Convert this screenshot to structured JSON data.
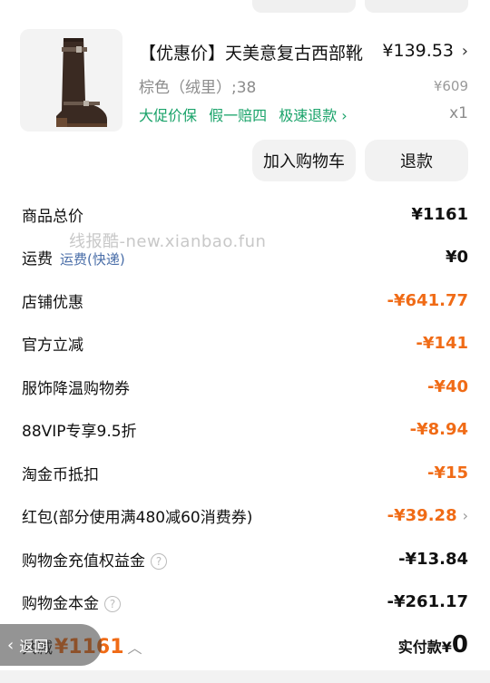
{
  "product": {
    "title": "【优惠价】天美意复古西部靴",
    "price": "¥139.53",
    "spec": "棕色（绒里）;38",
    "original_price": "¥609",
    "tags": [
      "大促价保",
      "假一赔四",
      "极速退款 ›"
    ],
    "quantity": "x1",
    "image_icon": "boot-image"
  },
  "actions": {
    "add_cart": "加入购物车",
    "refund": "退款"
  },
  "watermark": "线报酷-new.xianbao.fun",
  "rows": [
    {
      "label": "商品总价",
      "sub": "",
      "value": "¥1161",
      "orange": false,
      "help": false,
      "chevron": false
    },
    {
      "label": "运费",
      "sub": "运费(快递)",
      "value": "¥0",
      "orange": false,
      "help": false,
      "chevron": false
    },
    {
      "label": "店铺优惠",
      "sub": "",
      "value": "-¥641.77",
      "orange": true,
      "help": false,
      "chevron": false
    },
    {
      "label": "官方立减",
      "sub": "",
      "value": "-¥141",
      "orange": true,
      "help": false,
      "chevron": false
    },
    {
      "label": "服饰降温购物券",
      "sub": "",
      "value": "-¥40",
      "orange": true,
      "help": false,
      "chevron": false
    },
    {
      "label": "88VIP专享9.5折",
      "sub": "",
      "value": "-¥8.94",
      "orange": true,
      "help": false,
      "chevron": false
    },
    {
      "label": "淘金币抵扣",
      "sub": "",
      "value": "-¥15",
      "orange": true,
      "help": false,
      "chevron": false
    },
    {
      "label": "红包(部分使用满480减60消费券)",
      "sub": "",
      "value": "-¥39.28",
      "orange": true,
      "help": false,
      "chevron": true
    },
    {
      "label": "购物金充值权益金",
      "sub": "",
      "value": "-¥13.84",
      "orange": false,
      "help": true,
      "chevron": false
    },
    {
      "label": "购物金本金",
      "sub": "",
      "value": "-¥261.17",
      "orange": false,
      "help": true,
      "chevron": false
    }
  ],
  "footer": {
    "total_label": "共减",
    "total_amount": "¥1161",
    "pay_label": "实付款¥",
    "pay_amount": "0",
    "back_label": "返回"
  },
  "colors": {
    "accent": "#f06b16",
    "green": "#1aa36a",
    "link": "#4a6ea8"
  }
}
